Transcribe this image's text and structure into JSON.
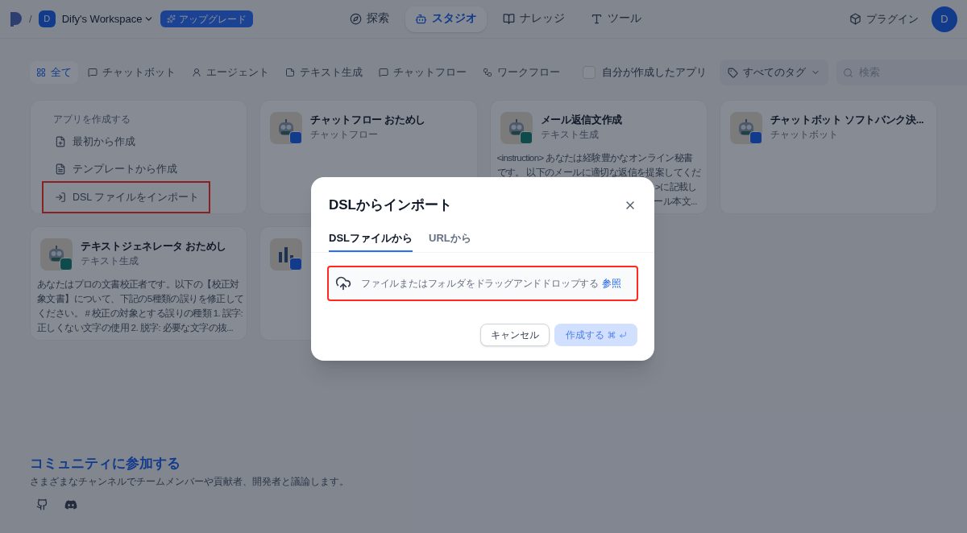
{
  "header": {
    "separator": "/",
    "workspace": {
      "avatar": "D",
      "name": "Dify's Workspace"
    },
    "upgrade": "アップグレード",
    "nav": [
      {
        "label": "探索",
        "selected": false
      },
      {
        "label": "スタジオ",
        "selected": true
      },
      {
        "label": "ナレッジ",
        "selected": false
      },
      {
        "label": "ツール",
        "selected": false
      }
    ],
    "plugins": "プラグイン",
    "user_avatar": "D"
  },
  "filters": {
    "tabs": [
      {
        "label": "全て",
        "selected": true
      },
      {
        "label": "チャットボット",
        "selected": false
      },
      {
        "label": "エージェント",
        "selected": false
      },
      {
        "label": "テキスト生成",
        "selected": false
      },
      {
        "label": "チャットフロー",
        "selected": false
      },
      {
        "label": "ワークフロー",
        "selected": false
      }
    ],
    "mine": {
      "label": "自分が作成したアプリ",
      "checked": false
    },
    "tags": "すべてのタグ",
    "search": {
      "placeholder": "検索"
    }
  },
  "create_card": {
    "heading": "アプリを作成する",
    "actions": [
      {
        "label": "最初から作成",
        "highlighted": false
      },
      {
        "label": "テンプレートから作成",
        "highlighted": false
      },
      {
        "label": "DSL ファイルをインポート",
        "highlighted": true
      }
    ]
  },
  "apps": [
    {
      "kind": "chatflow",
      "title": "チャットフロー おためし",
      "type": "チャットフロー"
    },
    {
      "kind": "text",
      "title": "メール返信文作成",
      "type": "テキスト生成",
      "description": [
        "<instruction> あなたは経験豊かなオンライン秘書",
        "です。 以下のメールに適切な返信を提案してくだ"
      ],
      "description_tail": [
        ">に記載し",
        "ール本文..."
      ]
    },
    {
      "kind": "chatbot",
      "title": "チャットボット ソフトバンク決...",
      "type": "チャットボット"
    },
    {
      "kind": "text",
      "title": "テキストジェネレータ おためし",
      "type": "テキスト生成",
      "description": [
        "あなたはプロの文書校正者です。以下の【校正対",
        "象文書】について、下記の5種類の誤りを修正して",
        "ください。 # 校正の対象とする誤りの種類 1. 誤字:",
        "正しくない文字の使用 2. 脱字: 必要な文字の抜..."
      ]
    },
    {
      "kind": "workflow"
    }
  ],
  "community": {
    "title": "コミュニティに参加する",
    "text": "さまざまなチャンネルでチームメンバーや貢献者、開発者と議論します。"
  },
  "dialog": {
    "title": "DSLからインポート",
    "tabs": [
      {
        "label": "DSLファイルから",
        "selected": true
      },
      {
        "label": "URLから",
        "selected": false
      }
    ],
    "dropzone": {
      "text": "ファイルまたはフォルダをドラッグアンドドロップする",
      "link": "参照",
      "highlighted": true
    },
    "cancel": "キャンセル",
    "create": {
      "label": "作成する",
      "disabled": true
    }
  }
}
